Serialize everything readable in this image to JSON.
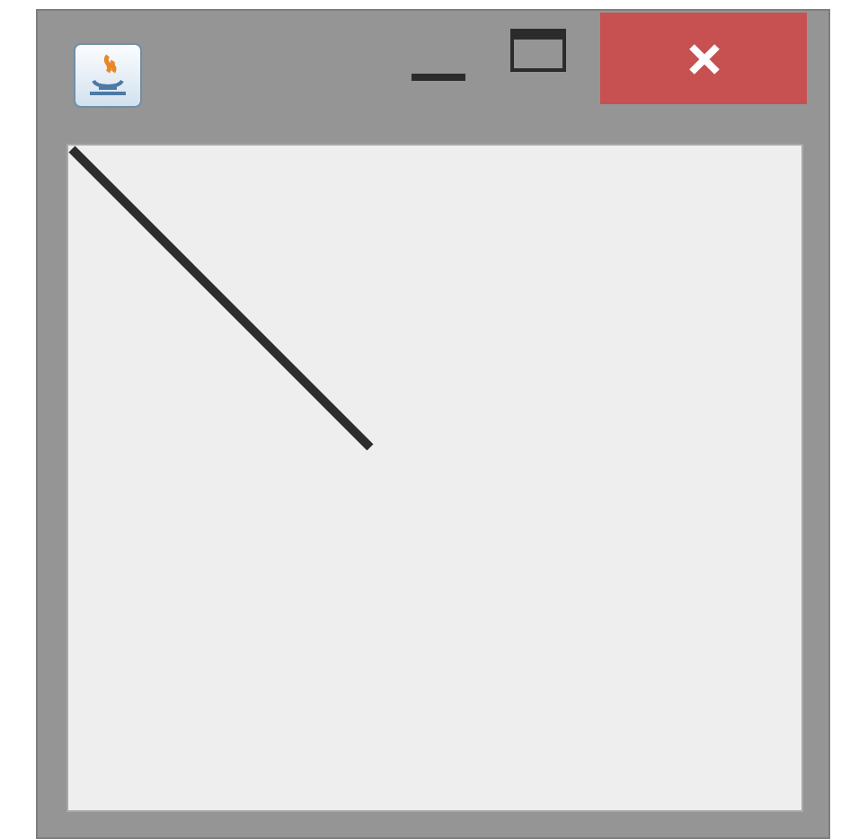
{
  "window": {
    "controls": [
      {
        "kind": "minimize"
      },
      {
        "kind": "maximize"
      },
      {
        "kind": "close"
      }
    ]
  },
  "canvas": {
    "kind": "line"
  }
}
